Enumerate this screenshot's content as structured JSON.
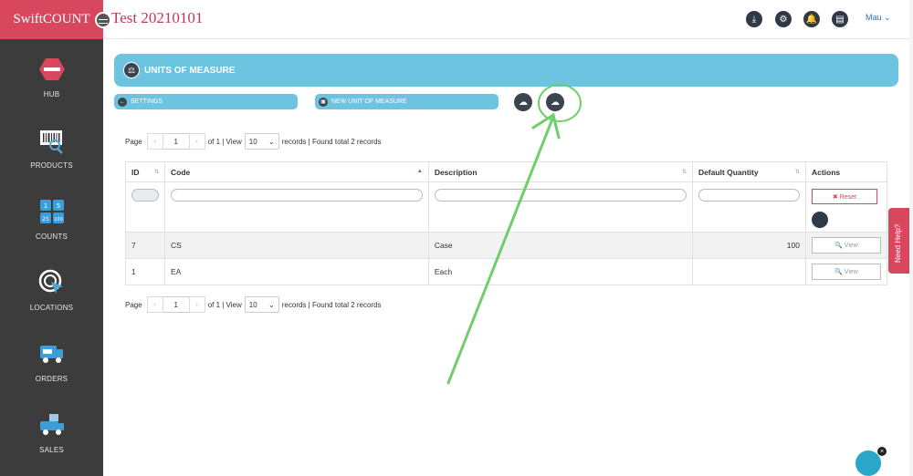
{
  "app": {
    "brand": "SwiftCOUNT",
    "title": "Test 20210101"
  },
  "header": {
    "user": "Mau",
    "icons": [
      "download-icon",
      "settings-icon",
      "bell-icon",
      "clipboard-icon"
    ]
  },
  "sidebar": {
    "items": [
      {
        "label": "HUB",
        "icon": "hub-icon"
      },
      {
        "label": "PRODUCTS",
        "icon": "barcode-icon"
      },
      {
        "label": "COUNTS",
        "icon": "counter-icon"
      },
      {
        "label": "LOCATIONS",
        "icon": "location-icon"
      },
      {
        "label": "ORDERS",
        "icon": "truck-icon"
      },
      {
        "label": "SALES",
        "icon": "delivery-icon"
      }
    ]
  },
  "page": {
    "title": "UNITS OF MEASURE",
    "settings_label": "SETTINGS",
    "new_unit_label": "NEW UNIT OF MEASURE"
  },
  "pager": {
    "page_label": "Page",
    "page_value": "1",
    "of_label": "of 1 | View",
    "view_value": "10",
    "records_label": "records | Found total 2 records"
  },
  "table": {
    "headers": {
      "id": "ID",
      "code": "Code",
      "description": "Description",
      "default_quantity": "Default Quantity",
      "actions": "Actions"
    },
    "reset_label": "✖ Reset",
    "view_label": "🔍 View",
    "rows": [
      {
        "id": "7",
        "code": "CS",
        "description": "Case",
        "default_quantity": "100"
      },
      {
        "id": "1",
        "code": "EA",
        "description": "Each",
        "default_quantity": ""
      }
    ]
  },
  "help": {
    "label": "Need Help?"
  },
  "colors": {
    "brand": "#d9475f",
    "accent": "#6cc4e0",
    "sidebar": "#3c3c3c",
    "annotation": "#6fce6a"
  }
}
